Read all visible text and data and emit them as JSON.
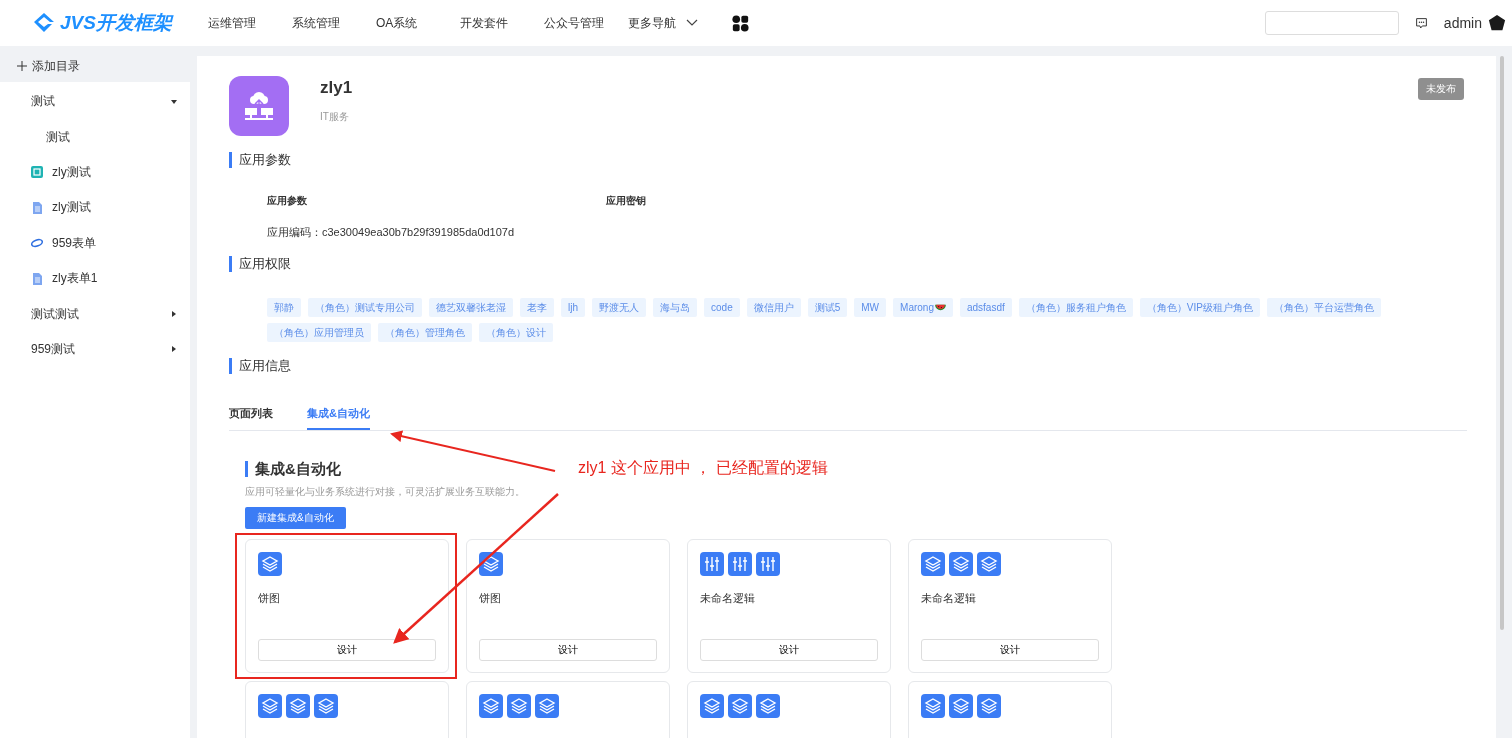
{
  "header": {
    "logo": "JVS开发框架",
    "nav": [
      {
        "label": "运维管理",
        "kind": "plain"
      },
      {
        "label": "系统管理",
        "kind": "plain"
      },
      {
        "label": "OA系统",
        "kind": "plain"
      },
      {
        "label": "开发套件",
        "kind": "plain"
      },
      {
        "label": "公众号管理",
        "kind": "plain"
      },
      {
        "label": "更多导航",
        "kind": "dropdown"
      }
    ],
    "user": "admin"
  },
  "sidebar": {
    "add": "添加目录",
    "items": [
      {
        "label": "测试",
        "kind": "folder",
        "expanded": true,
        "children": [
          {
            "label": "测试",
            "kind": "page"
          }
        ]
      },
      {
        "label": "zly测试",
        "kind": "app"
      },
      {
        "label": "zly测试",
        "kind": "doc"
      },
      {
        "label": "959表单",
        "kind": "ring"
      },
      {
        "label": "zly表单1",
        "kind": "doc"
      },
      {
        "label": "测试测试",
        "kind": "folder",
        "expanded": false
      },
      {
        "label": "959测试",
        "kind": "folder",
        "expanded": false
      }
    ]
  },
  "app": {
    "name": "zly1",
    "category": "IT服务",
    "status": "未发布"
  },
  "params": {
    "title": "应用参数",
    "col_1": "应用参数",
    "col_2": "应用密钥",
    "code": "应用编码：c3e30049ea30b7b29f391985da0d107d"
  },
  "permissions": {
    "title": "应用权限",
    "tags": [
      {
        "label": "郭静",
        "kind": "plain"
      },
      {
        "label": "（角色）测试专用公司",
        "kind": "plain"
      },
      {
        "label": "德艺双馨张老湿",
        "kind": "plain"
      },
      {
        "label": "老李",
        "kind": "plain"
      },
      {
        "label": "ljh",
        "kind": "plain"
      },
      {
        "label": "野渡无人",
        "kind": "plain"
      },
      {
        "label": "海与岛",
        "kind": "plain"
      },
      {
        "label": "code",
        "kind": "plain"
      },
      {
        "label": "微信用户",
        "kind": "plain"
      },
      {
        "label": "测试5",
        "kind": "plain"
      },
      {
        "label": "MW",
        "kind": "plain"
      },
      {
        "label": "Marong",
        "kind": "melon"
      },
      {
        "label": "adsfasdf",
        "kind": "plain"
      },
      {
        "label": "（角色）服务租户角色",
        "kind": "plain"
      },
      {
        "label": "（角色）VIP级租户角色",
        "kind": "plain"
      },
      {
        "label": "（角色）平台运营角色",
        "kind": "plain"
      },
      {
        "label": "（角色）应用管理员",
        "kind": "plain"
      },
      {
        "label": "（角色）管理角色",
        "kind": "plain"
      },
      {
        "label": "（角色）设计",
        "kind": "plain"
      }
    ]
  },
  "info": {
    "title": "应用信息",
    "tabs": [
      {
        "label": "页面列表",
        "selected": false
      },
      {
        "label": "集成&自动化",
        "selected": true
      }
    ]
  },
  "automation": {
    "title": "集成&自动化",
    "description": "应用可轻量化与业务系统进行对接，可灵活扩展业务互联能力。",
    "new_button": "新建集成&自动化",
    "cards": [
      {
        "icons": [
          {
            "kind": "layers"
          }
        ],
        "title": "饼图",
        "button": "设计",
        "highlighted": true
      },
      {
        "icons": [
          {
            "kind": "layers"
          }
        ],
        "title": "饼图",
        "button": "设计",
        "highlighted": false
      },
      {
        "icons": [
          {
            "kind": "sliders"
          },
          {
            "kind": "sliders"
          },
          {
            "kind": "sliders"
          }
        ],
        "title": "未命名逻辑",
        "button": "设计",
        "highlighted": false
      },
      {
        "icons": [
          {
            "kind": "layers"
          },
          {
            "kind": "layers"
          },
          {
            "kind": "layers"
          }
        ],
        "title": "未命名逻辑",
        "button": "设计",
        "highlighted": false
      },
      {
        "icons": [
          {
            "kind": "layers"
          },
          {
            "kind": "layers"
          },
          {
            "kind": "layers"
          }
        ],
        "highlighted": false
      },
      {
        "icons": [
          {
            "kind": "layers"
          },
          {
            "kind": "layers"
          },
          {
            "kind": "layers"
          }
        ],
        "highlighted": false
      },
      {
        "icons": [
          {
            "kind": "layers"
          },
          {
            "kind": "layers"
          },
          {
            "kind": "layers"
          }
        ],
        "highlighted": false
      },
      {
        "icons": [
          {
            "kind": "layers"
          },
          {
            "kind": "layers"
          },
          {
            "kind": "layers"
          }
        ],
        "highlighted": false
      }
    ]
  },
  "annotation": {
    "text": "zly1 这个应用中 ， 已经配置的逻辑"
  }
}
